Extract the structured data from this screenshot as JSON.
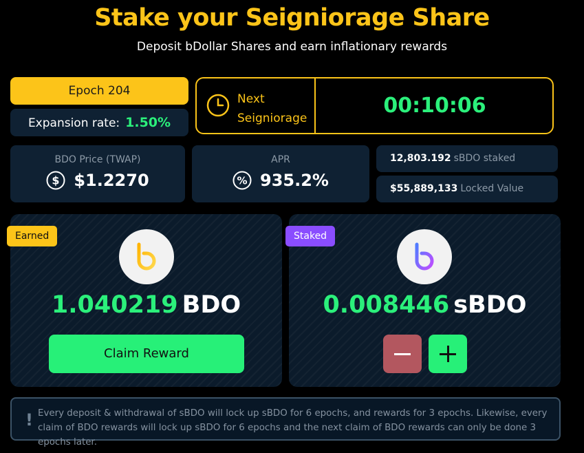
{
  "header": {
    "title": "Stake your Seigniorage Share",
    "subtitle": "Deposit bDollar Shares and earn inflationary rewards"
  },
  "epoch": {
    "label": "Epoch 204"
  },
  "expansion": {
    "label": "Expansion rate:",
    "value": "1.50%"
  },
  "seigniorage": {
    "label_line1": "Next",
    "label_line2": "Seigniorage",
    "countdown": "00:10:06"
  },
  "stats": {
    "price_label": "BDO Price (TWAP)",
    "price_value": "$1.2270",
    "apr_label": "APR",
    "apr_value": "935.2%",
    "staked_amount": "12,803.192",
    "staked_label": "sBDO staked",
    "locked_amount": "$55,889,133",
    "locked_label": "Locked Value"
  },
  "earned": {
    "badge": "Earned",
    "amount": "1.040219",
    "unit": "BDO",
    "button": "Claim Reward"
  },
  "staked": {
    "badge": "Staked",
    "amount": "0.008446",
    "unit": "sBDO"
  },
  "notice": {
    "mark": "!",
    "text": "Every deposit & withdrawal of sBDO will lock up sBDO for 6 epochs, and rewards for 3 epochs. Likewise, every claim of BDO rewards will lock up sBDO for 6 epochs and the next claim of BDO rewards can only be done 3 epochs later."
  },
  "colors": {
    "accent_yellow": "#fcc419",
    "accent_green": "#2bf07b",
    "card_bg": "#0f2133",
    "staked_badge": "#8a4dff",
    "minus_button": "#b3575f"
  },
  "icons": {
    "clock": "clock-icon",
    "dollar": "dollar-circle-icon",
    "percent": "percent-circle-icon",
    "bdo_logo": "bdo-logo-icon",
    "sbdo_logo": "sbdo-logo-icon",
    "minus": "minus-icon",
    "plus": "plus-icon"
  }
}
